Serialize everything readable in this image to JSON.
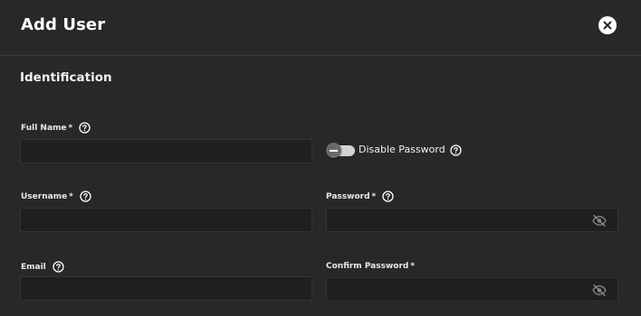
{
  "dialog": {
    "title": "Add User",
    "close_icon": "close-circle-icon"
  },
  "section": {
    "title": "Identification"
  },
  "fields": {
    "full_name": {
      "label": "Full Name",
      "required_mark": "*",
      "value": "",
      "help_icon": "help-circle-icon"
    },
    "disable_password": {
      "label": "Disable Password",
      "checked": false,
      "help_icon": "help-circle-icon"
    },
    "username": {
      "label": "Username",
      "required_mark": "*",
      "value": "",
      "help_icon": "help-circle-icon"
    },
    "password": {
      "label": "Password",
      "required_mark": "*",
      "value": "",
      "help_icon": "help-circle-icon",
      "visibility_icon": "eye-off-icon"
    },
    "email": {
      "label": "Email",
      "value": "",
      "help_icon": "help-circle-icon"
    },
    "confirm_password": {
      "label": "Confirm Password",
      "required_mark": "*",
      "value": "",
      "visibility_icon": "eye-off-icon"
    }
  },
  "colors": {
    "background": "#282828",
    "input_background": "#1f1f1f",
    "text": "#ffffff"
  }
}
